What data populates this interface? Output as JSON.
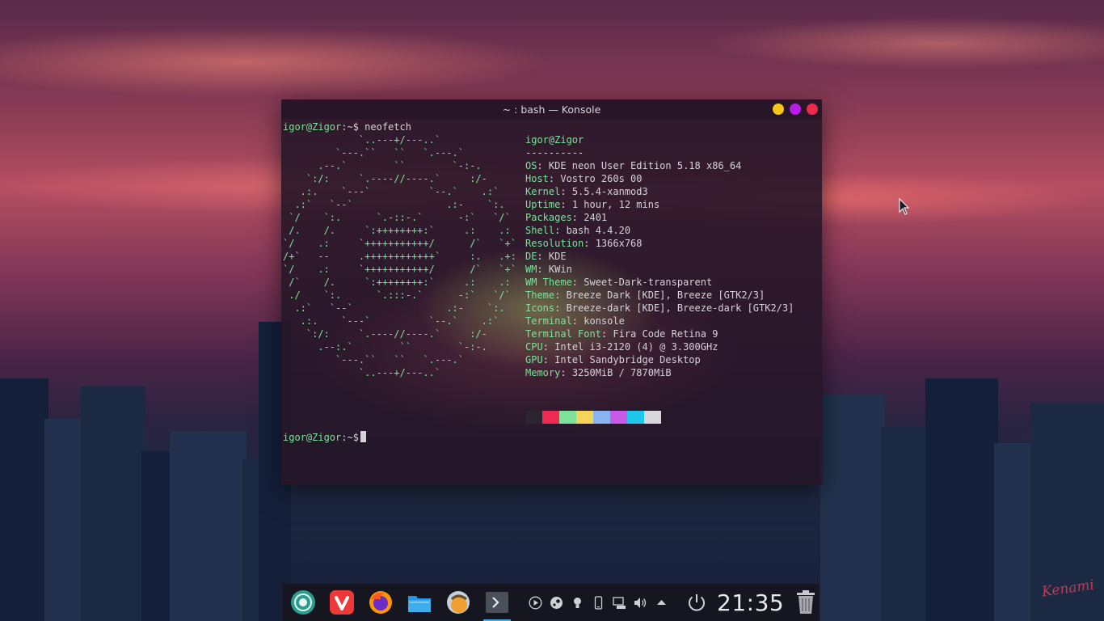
{
  "window": {
    "title": "~ : bash — Konsole",
    "controls": [
      "minimize",
      "maximize",
      "close"
    ]
  },
  "terminal": {
    "prompt_user": "igor@Zigor",
    "prompt_suffix": ":~$",
    "command": " neofetch",
    "logo_lines": [
      "             `..---+/---..`",
      "         `---.``   ``   `.---.`",
      "      .--.`        ``        `-:-.",
      "    `:/:     `.----//----.`     :/-",
      "   .:.    `---`          `--.`    .:`",
      "  .:`   `--`                .:-    `:.",
      " `/    `:.      `.-::-.`      -:`   `/`",
      " /.    /.     `:++++++++:`     .:    .:",
      "`/    .:     `+++++++++++/      /`   `+`",
      "/+`   --     .++++++++++++`     :.   .+:",
      "`/    .:     `+++++++++++/      /`   `+`",
      " /`    /.     `:++++++++:`     .:    .:",
      " ./    `:.      `.:::-.`      -:`   `/`",
      "  .:`   `--`                .:-    `:.",
      "   .:.    `---`          `--.`    .:`",
      "    `:/:     `.----//----.`     :/-",
      "      .--:.`        ``        `-:-.",
      "         `---.``   ``   `.---.`",
      "             `..---+/---..`"
    ],
    "info_header": "igor@Zigor",
    "info_separator": "----------",
    "info": [
      {
        "key": "OS",
        "value": "KDE neon User Edition 5.18 x86_64"
      },
      {
        "key": "Host",
        "value": "Vostro 260s 00"
      },
      {
        "key": "Kernel",
        "value": "5.5.4-xanmod3"
      },
      {
        "key": "Uptime",
        "value": "1 hour, 12 mins"
      },
      {
        "key": "Packages",
        "value": "2401"
      },
      {
        "key": "Shell",
        "value": "bash 4.4.20"
      },
      {
        "key": "Resolution",
        "value": "1366x768"
      },
      {
        "key": "DE",
        "value": "KDE"
      },
      {
        "key": "WM",
        "value": "KWin"
      },
      {
        "key": "WM Theme",
        "value": "Sweet-Dark-transparent"
      },
      {
        "key": "Theme",
        "value": "Breeze Dark [KDE], Breeze [GTK2/3]"
      },
      {
        "key": "Icons",
        "value": "Breeze-dark [KDE], Breeze-dark [GTK2/3]"
      },
      {
        "key": "Terminal",
        "value": "konsole"
      },
      {
        "key": "Terminal Font",
        "value": "Fira Code Retina 9"
      },
      {
        "key": "CPU",
        "value": "Intel i3-2120 (4) @ 3.300GHz"
      },
      {
        "key": "GPU",
        "value": "Intel Sandybridge Desktop"
      },
      {
        "key": "Memory",
        "value": "3250MiB / 7870MiB"
      }
    ],
    "palette": [
      "#2a2530",
      "#ee2a55",
      "#7ee29a",
      "#f5d45a",
      "#8ab4f0",
      "#c85ae8",
      "#1ec8e8",
      "#d8d8dc"
    ]
  },
  "taskbar": {
    "apps": [
      {
        "name": "app-launcher",
        "icon": "launcher-icon",
        "color": "#2a9d8f"
      },
      {
        "name": "vivaldi",
        "icon": "vivaldi-icon",
        "color": "#ef3939"
      },
      {
        "name": "firefox",
        "icon": "firefox-icon",
        "color": "#ff9500"
      },
      {
        "name": "dolphin",
        "icon": "folder-icon",
        "color": "#3daee9"
      },
      {
        "name": "thunderbird",
        "icon": "mail-icon",
        "color": "#e8a030"
      },
      {
        "name": "konsole",
        "icon": "terminal-icon",
        "color": "#4a4f5a"
      }
    ],
    "tray": [
      "media-play-icon",
      "steam-icon",
      "lightbulb-icon",
      "phone-icon",
      "network-icon",
      "volume-icon",
      "expand-arrow-icon"
    ],
    "clock": "21:35"
  },
  "wallpaper_signature": "Kenami"
}
